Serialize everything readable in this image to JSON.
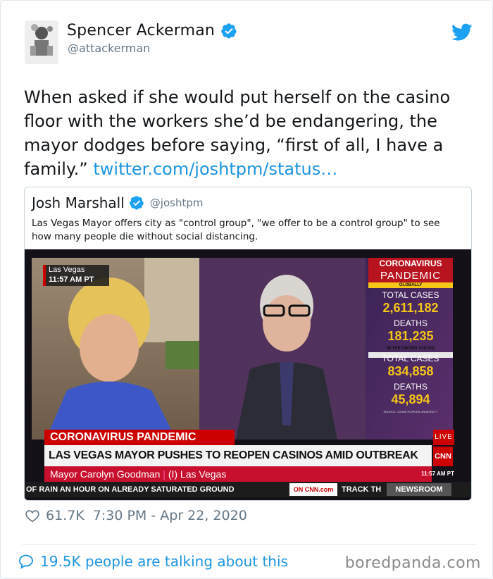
{
  "tweet": {
    "author": {
      "display_name": "Spencer Ackerman",
      "handle": "@attackerman",
      "verified": true
    },
    "text": "When asked if she would put herself on the casino floor with the workers she’d be endangering, the mayor dodges before saying, “first of all, I have a family.”",
    "link": "twitter.com/joshtpm/status…",
    "likes": "61.7K",
    "timestamp": "7:30 PM - Apr 22, 2020",
    "talking": "19.5K people are talking about this"
  },
  "quoted": {
    "display_name": "Josh Marshall",
    "handle": "@joshtpm",
    "text": "Las Vegas Mayor offers city as \"control group\", \"we offer to be a control group\" to see how many people die without social distancing."
  },
  "video": {
    "location": "Las Vegas",
    "time": "11:57 AM PT",
    "panel_title_1": "CORONAVIRUS",
    "panel_title_2": "PANDEMIC",
    "globally": "GLOBALLY",
    "total_cases_label": "TOTAL CASES",
    "global_cases": "2,611,182",
    "deaths_label": "DEATHS",
    "global_deaths": "181,235",
    "us_label": "IN THE UNITED STATES",
    "us_cases": "834,858",
    "us_deaths": "45,894",
    "source": "SOURCE: JOHNS HOPKINS UNIVERSITY",
    "banner_top": "CORONAVIRUS PANDEMIC",
    "live": "LIVE",
    "headline": "LAS VEGAS MAYOR PUSHES TO REOPEN CASINOS AMID OUTBREAK",
    "name_line": "Mayor Carolyn Goodman",
    "name_loc": "(I) Las Vegas",
    "cnn_time": "11:57 AM PT",
    "ticker": "OF RAIN AN HOUR ON ALREADY SATURATED GROUND",
    "on_cnn": "ON CNN.com",
    "track": "TRACK TH",
    "newsroom": "NEWSROOM",
    "cnn": "CNN"
  },
  "watermark": "boredpanda.com",
  "colors": {
    "link": "#1b95e0",
    "cnn_red": "#cc0000",
    "gold": "#f5c518",
    "muted": "#657786"
  }
}
